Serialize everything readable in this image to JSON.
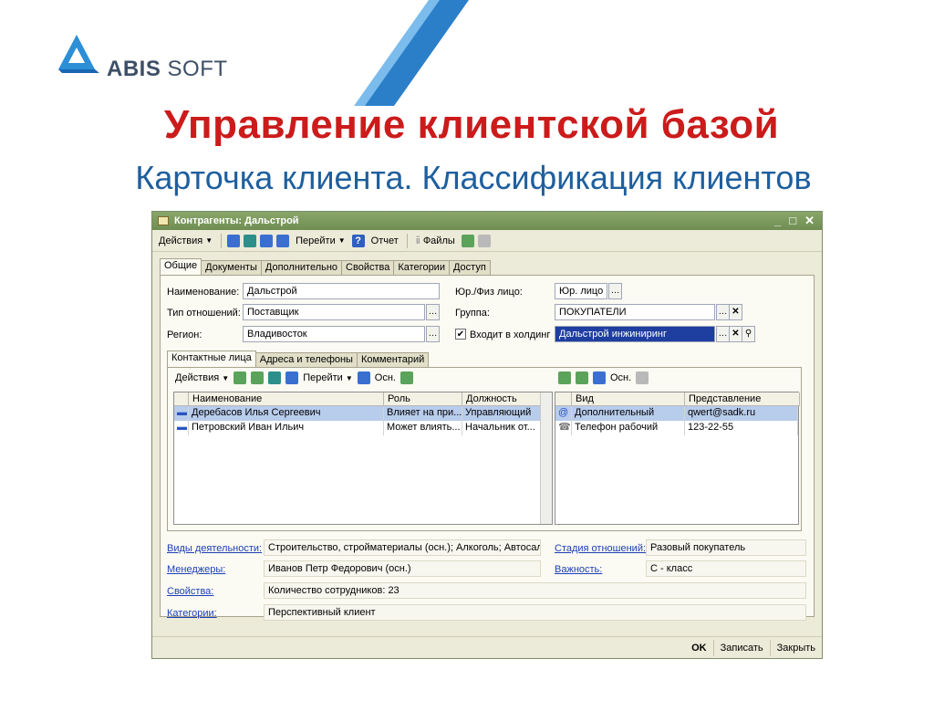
{
  "logo": {
    "brand_bold": "ABIS",
    "brand_rest": " SOFT"
  },
  "title": "Управление клиентской базой",
  "subtitle": "Карточка клиента. Классификация клиентов",
  "window": {
    "title": "Контрагенты: Дальстрой",
    "toolbar": {
      "actions": "Действия",
      "goto": "Перейти",
      "report": "Отчет",
      "files": "Файлы"
    },
    "tabs": [
      "Общие",
      "Документы",
      "Дополнительно",
      "Свойства",
      "Категории",
      "Доступ"
    ],
    "fields": {
      "name_label": "Наименование:",
      "name_value": "Дальстрой",
      "rel_label": "Тип отношений:",
      "rel_value": "Поставщик",
      "region_label": "Регион:",
      "region_value": "Владивосток",
      "legal_label": "Юр./Физ лицо:",
      "legal_value": "Юр. лицо",
      "group_label": "Группа:",
      "group_value": "ПОКУПАТЕЛИ",
      "holding_label": "Входит в холдинг",
      "holding_value": "Дальстрой инжиниринг"
    },
    "subtabs": [
      "Контактные лица",
      "Адреса и телефоны",
      "Комментарий"
    ],
    "sub_toolbar": {
      "actions": "Действия",
      "goto": "Перейти",
      "main": "Осн.",
      "main2": "Осн."
    },
    "contacts": {
      "headers": [
        "Наименование",
        "Роль",
        "Должность"
      ],
      "rows": [
        [
          "Деребасов Илья Сергеевич",
          "Влияет на при...",
          "Управляющий"
        ],
        [
          "Петровский Иван Ильич",
          "Может влиять...",
          "Начальник от..."
        ]
      ]
    },
    "addresses": {
      "headers": [
        "Вид",
        "Представление"
      ],
      "rows": [
        [
          "Дополнительный",
          "qwert@sadk.ru"
        ],
        [
          "Телефон рабочий",
          "123-22-55"
        ]
      ]
    },
    "info": {
      "activity_label": "Виды деятельности:",
      "activity_value": "Строительство, стройматериалы (осн.); Алкоголь; Автосал",
      "managers_label": "Менеджеры:",
      "managers_value": "Иванов Петр Федорович (осн.)",
      "props_label": "Свойства:",
      "props_value": "Количество сотрудников: 23",
      "cats_label": "Категории:",
      "cats_value": "Перспективный клиент",
      "stage_label": "Стадия отношений:",
      "stage_value": "Разовый покупатель",
      "importance_label": "Важность:",
      "importance_value": "С - класс"
    },
    "buttons": {
      "ok": "OK",
      "save": "Записать",
      "close": "Закрыть"
    }
  },
  "colors": {
    "title_red": "#cc1b1b",
    "subtitle_blue": "#1e5f9e",
    "window_title": "#7a9a5c"
  }
}
